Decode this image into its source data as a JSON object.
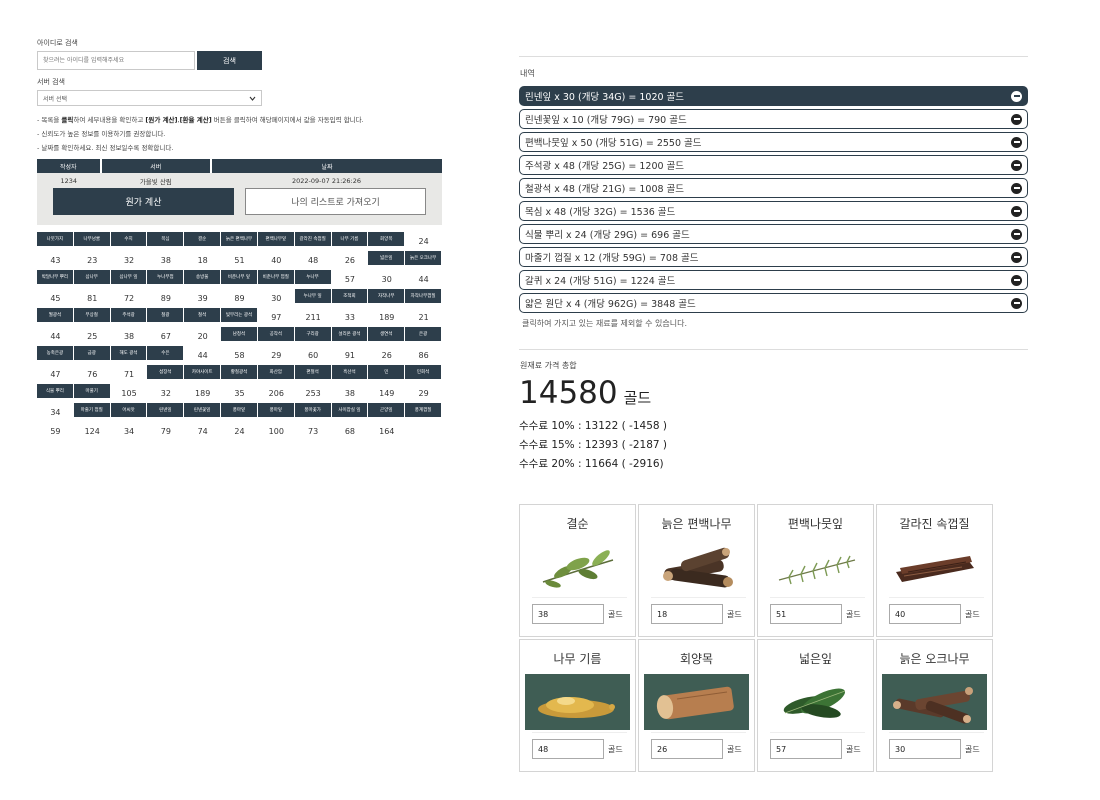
{
  "search": {
    "id_label": "아이디로 검색",
    "id_placeholder": "찾으려는 아이디를 입력해주세요",
    "search_button": "검색",
    "server_label": "서버 검색",
    "server_select": "서버 선택"
  },
  "notes": {
    "n1_a": "- 목록을 ",
    "n1_b": "클릭",
    "n1_c": "하여 세부내용을 확인하고 ",
    "n1_d": "[원가 계산]",
    "n1_e": ",",
    "n1_f": "[환율 계산]",
    "n1_g": " 버튼을 클릭하여 해당페이지에서 값을 자동입력 합니다.",
    "n2": "- 신뢰도가 높은 정보를 이용하기를 권장합니다.",
    "n3": "- 날짜를 확인하세요. 최신 정보일수록 정확합니다."
  },
  "info": {
    "headers": [
      "작성자",
      "서버",
      "날짜"
    ],
    "author": "1234",
    "server": "가을빛 산림",
    "date": "2022-09-07 21:26:26",
    "calc_button": "원가 계산",
    "list_button": "나의 리스트로 가져오기"
  },
  "price_grid": [
    [
      {
        "h": "나뭇가지",
        "v": "24"
      },
      {
        "h": "나무넝쿨",
        "v": "43"
      },
      {
        "h": "수지",
        "v": "23"
      },
      {
        "h": "목심",
        "v": "32"
      },
      {
        "h": "결순",
        "v": "38"
      },
      {
        "h": "늙은 편백나무",
        "v": "18"
      },
      {
        "h": "편백나무잎",
        "v": "51"
      },
      {
        "h": "갈라진 속껍질",
        "v": "40"
      },
      {
        "h": "나무 기름",
        "v": "48"
      },
      {
        "h": "회양목",
        "v": "26"
      }
    ],
    [
      {
        "h": "넓은잎",
        "v": "57"
      },
      {
        "h": "늙은 오크나무",
        "v": "30"
      },
      {
        "h": "박달나무 뿌리",
        "v": "44"
      },
      {
        "h": "삼나무",
        "v": "45"
      },
      {
        "h": "삼나무 잎",
        "v": "81"
      },
      {
        "h": "누나무껍",
        "v": "72"
      },
      {
        "h": "송방울",
        "v": "89"
      },
      {
        "h": "비춘나무 잎",
        "v": "39"
      },
      {
        "h": "비춘나무 껍질",
        "v": "89"
      },
      {
        "h": "누나무",
        "v": "30"
      }
    ],
    [
      {
        "h": "누나무 잎",
        "v": "97"
      },
      {
        "h": "조적회",
        "v": "211"
      },
      {
        "h": "자작나무",
        "v": "33"
      },
      {
        "h": "자작나무껍질",
        "v": "189"
      },
      {
        "h": "월광석",
        "v": "21"
      },
      {
        "h": "무상철",
        "v": "44"
      },
      {
        "h": "주석광",
        "v": "25"
      },
      {
        "h": "철광",
        "v": "38"
      },
      {
        "h": "철석",
        "v": "67"
      },
      {
        "h": "빛무리는 광석",
        "v": "20"
      }
    ],
    [
      {
        "h": "남청석",
        "v": "44"
      },
      {
        "h": "공작석",
        "v": "58"
      },
      {
        "h": "구리광",
        "v": "29"
      },
      {
        "h": "설리온 광석",
        "v": "60"
      },
      {
        "h": "생연석",
        "v": "91"
      },
      {
        "h": "은광",
        "v": "26"
      },
      {
        "h": "농축은광",
        "v": "86"
      },
      {
        "h": "금광",
        "v": "47"
      },
      {
        "h": "해도 광석",
        "v": "76"
      },
      {
        "h": "수은",
        "v": "71"
      }
    ],
    [
      {
        "h": "섬장석",
        "v": "105"
      },
      {
        "h": "카야사이트",
        "v": "32"
      },
      {
        "h": "황철광석",
        "v": "189"
      },
      {
        "h": "화산암",
        "v": "35"
      },
      {
        "h": "편철석",
        "v": "206"
      },
      {
        "h": "흑산석",
        "v": "253"
      },
      {
        "h": "민",
        "v": "38"
      },
      {
        "h": "민회석",
        "v": "149"
      },
      {
        "h": "식물 뿌리",
        "v": "29"
      },
      {
        "h": "마풀기",
        "v": "34"
      }
    ],
    [
      {
        "h": "마줄기 껍질",
        "v": "59"
      },
      {
        "h": "어씨앗",
        "v": "124"
      },
      {
        "h": "린넨잎",
        "v": "34"
      },
      {
        "h": "린넨꽃잎",
        "v": "79"
      },
      {
        "h": "풍마잎",
        "v": "74"
      },
      {
        "h": "풍마잎",
        "v": "24"
      },
      {
        "h": "풍마꽃가",
        "v": "100"
      },
      {
        "h": "사이잡실 잎",
        "v": "73"
      },
      {
        "h": "곤양잎",
        "v": "68"
      },
      {
        "h": "풍계껍질",
        "v": "164"
      }
    ]
  ],
  "history": {
    "title": "내역",
    "items": [
      "린넨잎 x 30 (개당 34G) = 1020 골드",
      "린넨꽃잎 x 10 (개당 79G) = 790 골드",
      "편백나뭇잎 x 50 (개당 51G) = 2550 골드",
      "주석광 x 48 (개당 25G) = 1200 골드",
      "철광석 x 48 (개당 21G) = 1008 골드",
      "목심 x 48 (개당 32G) = 1536 골드",
      "식물 뿌리 x 24 (개당 29G) = 696 골드",
      "마줄기 껍질 x 12 (개당 59G) = 708 골드",
      "갈퀴 x 24 (개당 51G) = 1224 골드",
      "얇은 원단 x 4 (개당 962G) = 3848 골드"
    ],
    "hint": "클릭하여 가지고 있는 재료를 제외할 수 있습니다."
  },
  "total": {
    "title": "원재료 가격 총합",
    "value": "14580",
    "unit": "골드",
    "fee10": "수수료 10% : 13122 ( -1458 )",
    "fee15": "수수료 15% : 12393 ( -2187 )",
    "fee20": "수수료 20% : 11664 ( -2916)"
  },
  "cards": [
    {
      "name": "결순",
      "value": "38",
      "unit": "골드",
      "icon": "leaf-sprig-icon"
    },
    {
      "name": "늙은 편백나무",
      "value": "18",
      "unit": "골드",
      "icon": "log-pile-icon"
    },
    {
      "name": "편백나뭇잎",
      "value": "51",
      "unit": "골드",
      "icon": "fern-icon"
    },
    {
      "name": "갈라진 속껍질",
      "value": "40",
      "unit": "골드",
      "icon": "bark-icon"
    },
    {
      "name": "나무 기름",
      "value": "48",
      "unit": "골드",
      "icon": "oil-puddle-icon"
    },
    {
      "name": "회양목",
      "value": "26",
      "unit": "골드",
      "icon": "log-icon"
    },
    {
      "name": "넓은잎",
      "value": "57",
      "unit": "골드",
      "icon": "broad-leaves-icon"
    },
    {
      "name": "늙은 오크나무",
      "value": "30",
      "unit": "골드",
      "icon": "oak-logs-icon"
    }
  ]
}
